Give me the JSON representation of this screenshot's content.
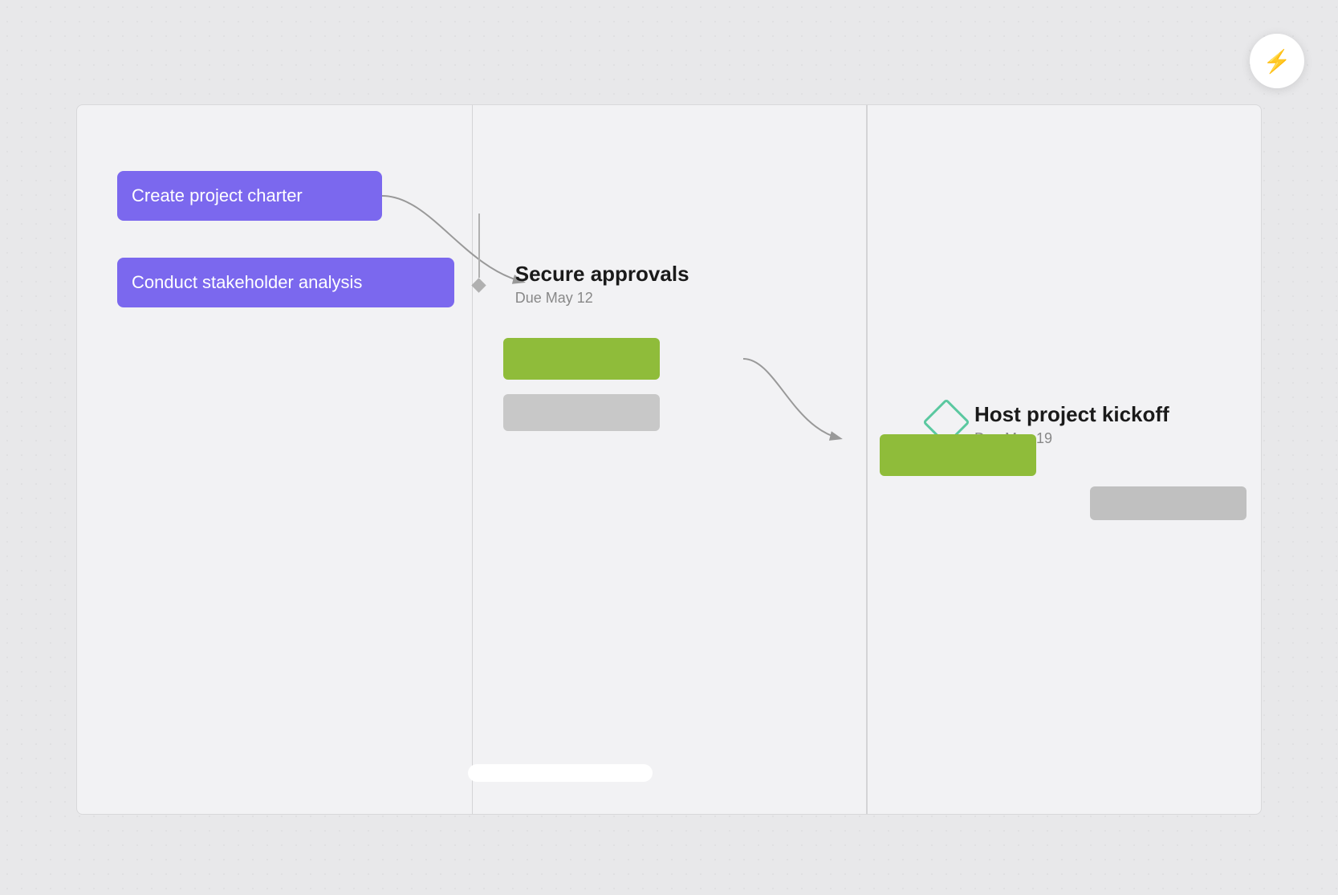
{
  "lightning_button": {
    "label": "⚡",
    "aria": "lightning-action"
  },
  "tasks": {
    "task1": {
      "label": "Create project charter"
    },
    "task2": {
      "label": "Conduct stakeholder analysis"
    }
  },
  "milestones": {
    "approval": {
      "title": "Secure approvals",
      "due": "Due May 12"
    },
    "kickoff": {
      "title": "Host project kickoff",
      "due": "Due May 19"
    }
  },
  "colors": {
    "purple": "#7b68ee",
    "green": "#8fbc3a",
    "gray": "#c8c8c8",
    "diamond_outline": "#5bc8a0",
    "lightning": "#f0a020"
  }
}
